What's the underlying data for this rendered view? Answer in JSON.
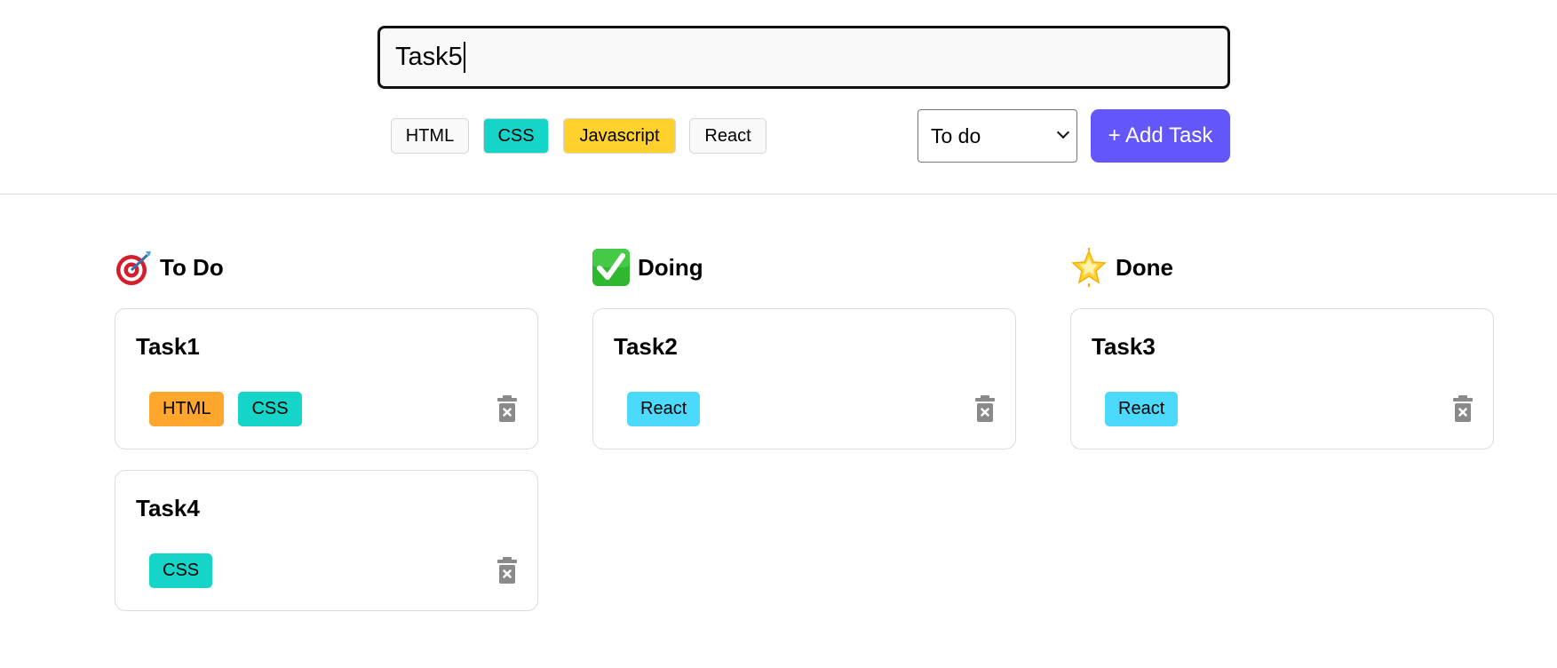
{
  "form": {
    "task_value": "Task5",
    "tags": [
      {
        "label": "HTML",
        "color": "#f9f9f9"
      },
      {
        "label": "CSS",
        "color": "#15d4c8"
      },
      {
        "label": "Javascript",
        "color": "#ffd12c"
      },
      {
        "label": "React",
        "color": "#f9f9f9"
      }
    ],
    "status_selected": "To do",
    "add_label": "+ Add Task",
    "add_color": "#6457f9"
  },
  "columns": [
    {
      "title": "To Do",
      "icon": "dart-target-icon",
      "cards": [
        {
          "title": "Task1",
          "tags": [
            {
              "label": "HTML",
              "color": "#ffa62c"
            },
            {
              "label": "CSS",
              "color": "#15d4c8"
            }
          ]
        },
        {
          "title": "Task4",
          "tags": [
            {
              "label": "CSS",
              "color": "#15d4c8"
            }
          ]
        }
      ]
    },
    {
      "title": "Doing",
      "icon": "check-mark-button-icon",
      "cards": [
        {
          "title": "Task2",
          "tags": [
            {
              "label": "React",
              "color": "#4cdafc"
            }
          ]
        }
      ]
    },
    {
      "title": "Done",
      "icon": "glowing-star-icon",
      "cards": [
        {
          "title": "Task3",
          "tags": [
            {
              "label": "React",
              "color": "#4cdafc"
            }
          ]
        }
      ]
    }
  ]
}
